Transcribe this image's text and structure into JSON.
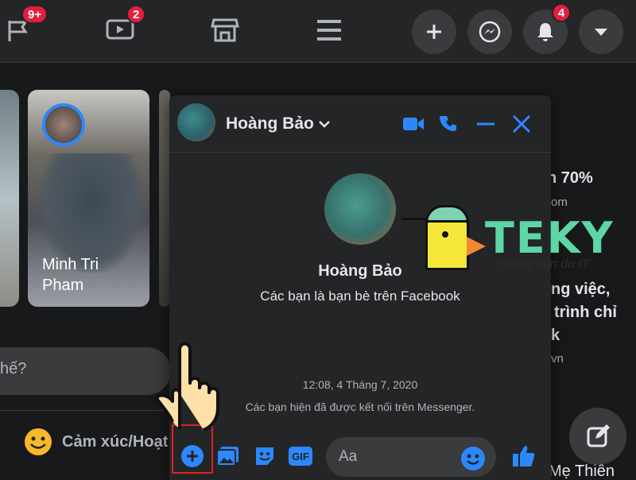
{
  "topbar": {
    "flag_badge": "9+",
    "watch_badge": "2",
    "notification_badge": "4"
  },
  "stories": [
    {
      "name": "Minh Tri\nPham"
    }
  ],
  "right_feed": {
    "line1": "n 70%",
    "line2": "om",
    "line3": "ng việc,",
    "line4": "trình chỉ",
    "line5": "k",
    "line6": "vn",
    "bottom": "Mẹ Thiên"
  },
  "composer": {
    "placeholder_tail": "hế?",
    "feeling_label": "Cảm xúc/Hoạt"
  },
  "chat": {
    "title": "Hoàng Bảo",
    "profile_name": "Hoàng Bảo",
    "profile_sub": "Các bạn là bạn bè trên Facebook",
    "timestamp": "12:08, 4 Tháng 7, 2020",
    "connected_text": "Các bạn hiện đã được kết nối trên Messenger.",
    "input_placeholder": "Aa",
    "gif_label": "GIF"
  },
  "logo": {
    "word": "TEKY",
    "tagline": "Young can do IT"
  },
  "colors": {
    "accent": "#2d88ff",
    "badge": "#e41e3f",
    "highlight": "#e02020"
  }
}
